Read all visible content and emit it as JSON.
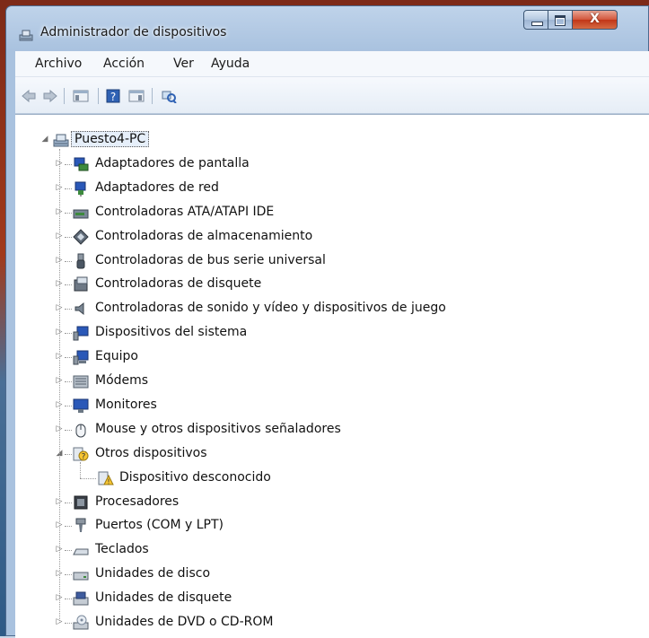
{
  "window": {
    "title": "Administrador de dispositivos",
    "close_glyph": "X"
  },
  "menu": [
    "Archivo",
    "Acción",
    "Ver",
    "Ayuda"
  ],
  "toolbar_icons": [
    "back-arrow-icon",
    "forward-arrow-icon",
    "console-tree-icon",
    "help-icon",
    "action-pane-icon",
    "scan-hardware-icon"
  ],
  "tree": {
    "root": "Puesto4-PC",
    "categories": [
      {
        "label": "Adaptadores de pantalla",
        "icon": "display-adapter-icon",
        "expander": "collapsed"
      },
      {
        "label": "Adaptadores de red",
        "icon": "network-adapter-icon",
        "expander": "collapsed"
      },
      {
        "label": "Controladoras ATA/ATAPI IDE",
        "icon": "ide-controller-icon",
        "expander": "collapsed"
      },
      {
        "label": "Controladoras de almacenamiento",
        "icon": "storage-controller-icon",
        "expander": "collapsed"
      },
      {
        "label": "Controladoras de bus serie universal",
        "icon": "usb-icon",
        "expander": "collapsed"
      },
      {
        "label": "Controladoras de disquete",
        "icon": "floppy-controller-icon",
        "expander": "collapsed"
      },
      {
        "label": "Controladoras de sonido y vídeo y dispositivos de juego",
        "icon": "speaker-icon",
        "expander": "collapsed"
      },
      {
        "label": "Dispositivos del sistema",
        "icon": "system-device-icon",
        "expander": "collapsed"
      },
      {
        "label": "Equipo",
        "icon": "computer-icon",
        "expander": "collapsed"
      },
      {
        "label": "Módems",
        "icon": "modem-icon",
        "expander": "collapsed"
      },
      {
        "label": "Monitores",
        "icon": "monitor-icon",
        "expander": "collapsed"
      },
      {
        "label": "Mouse y otros dispositivos señaladores",
        "icon": "mouse-icon",
        "expander": "collapsed"
      },
      {
        "label": "Otros dispositivos",
        "icon": "unknown-device-icon",
        "expander": "expanded",
        "children": [
          {
            "label": "Dispositivo desconocido",
            "icon": "warning-device-icon"
          }
        ]
      },
      {
        "label": "Procesadores",
        "icon": "processor-icon",
        "expander": "collapsed"
      },
      {
        "label": "Puertos (COM y LPT)",
        "icon": "port-icon",
        "expander": "collapsed"
      },
      {
        "label": "Teclados",
        "icon": "keyboard-icon",
        "expander": "collapsed"
      },
      {
        "label": "Unidades de disco",
        "icon": "disk-drive-icon",
        "expander": "collapsed"
      },
      {
        "label": "Unidades de disquete",
        "icon": "floppy-drive-icon",
        "expander": "collapsed"
      },
      {
        "label": "Unidades de DVD o CD-ROM",
        "icon": "dvd-drive-icon",
        "expander": "collapsed"
      }
    ]
  }
}
